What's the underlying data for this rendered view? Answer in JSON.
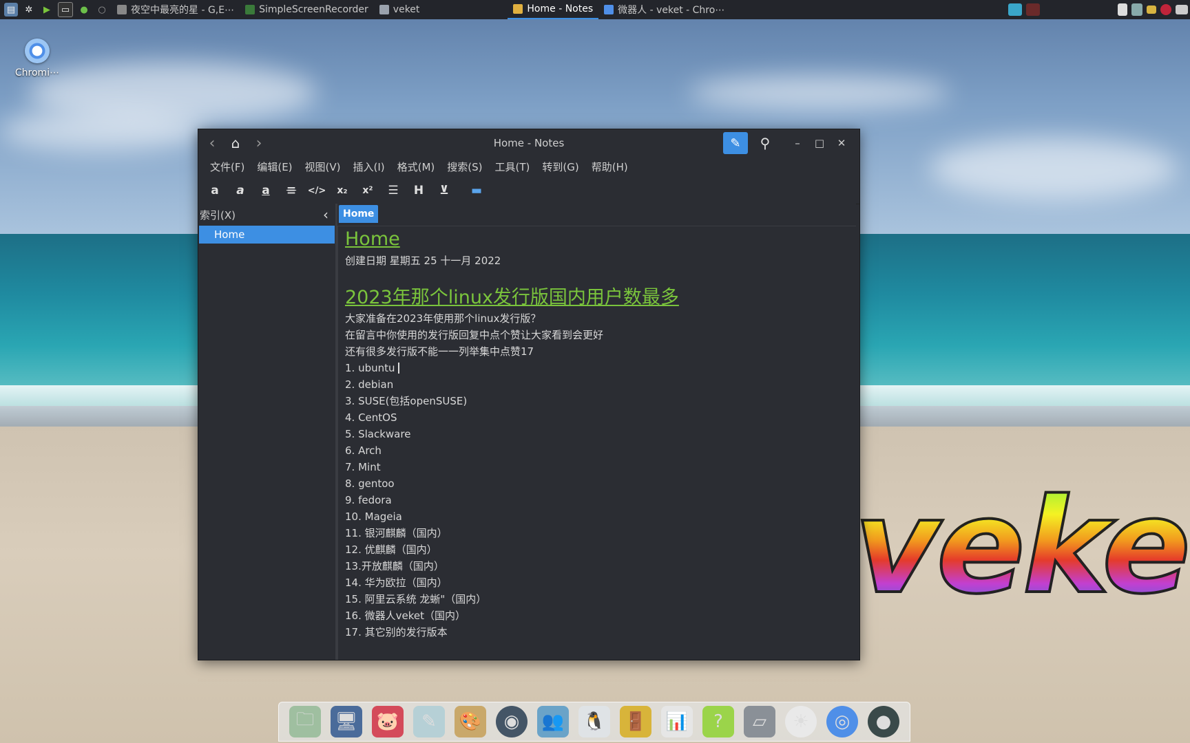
{
  "panel": {
    "tasks": [
      {
        "label": "夜空中最亮的星 - G,E⋯",
        "color": "#888888"
      },
      {
        "label": "SimpleScreenRecorder",
        "color": "#3a7a3a"
      },
      {
        "label": "veket",
        "color": "#9aa2ad"
      },
      {
        "label": "Home - Notes",
        "color": "#e0b040"
      },
      {
        "label": "微器人 - veket - Chro⋯",
        "color": "#4f8fe8"
      }
    ]
  },
  "desktop": {
    "chrome_label": "Chromi⋯",
    "logo_text": "veket"
  },
  "window": {
    "title": "Home - Notes",
    "menu": [
      "文件(F)",
      "编辑(E)",
      "视图(V)",
      "插入(I)",
      "格式(M)",
      "搜索(S)",
      "工具(T)",
      "转到(G)",
      "帮助(H)"
    ],
    "toolbar_icons": [
      "bold-icon",
      "italic-icon",
      "underline-icon",
      "strikethrough-icon",
      "code-icon",
      "subscript-icon",
      "superscript-icon",
      "bullet-list-icon",
      "heading-icon",
      "insert-icon",
      "folder-icon"
    ],
    "sidebar": {
      "header": "索引(X)",
      "items": [
        "Home"
      ]
    },
    "tab": "Home",
    "page": {
      "title": "Home",
      "created": "创建日期 星期五 25 十一月 2022",
      "heading": "2023年那个linux发行版国内用户数最多",
      "lines": [
        "大家准备在2023年使用那个linux发行版？",
        "在留言中你使用的发行版回复中点个赞让大家看到会更好",
        "还有很多发行版不能一一列举集中点赞17",
        "1. ubuntu",
        "2. debian",
        "3. SUSE(包括openSUSE)",
        "4. CentOS",
        "5. Slackware",
        "6. Arch",
        "7. Mint",
        "8. gentoo",
        "9. fedora",
        "10. Mageia",
        "11. 银河麒麟（国内）",
        "12. 优麒麟（国内）",
        "13.开放麒麟（国内）",
        "14. 华为欧拉（国内）",
        "15. 阿里云系统 龙蜥\"（国内）",
        "16. 微器人veket（国内）",
        "17. 其它别的发行版本"
      ]
    }
  }
}
